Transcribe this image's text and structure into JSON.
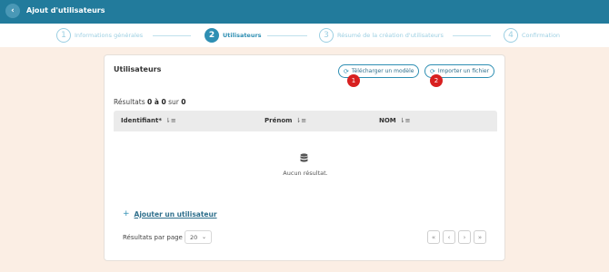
{
  "header": {
    "back_icon": "chevron-left-icon",
    "title": "Ajout d'utilisateurs"
  },
  "stepper": {
    "steps": [
      {
        "number": "1",
        "label": "Informations générales",
        "state": "done"
      },
      {
        "number": "2",
        "label": "Utilisateurs",
        "state": "active"
      },
      {
        "number": "3",
        "label": "Résumé de la création d'utilisateurs",
        "state": "pending"
      },
      {
        "number": "4",
        "label": "Confirmation",
        "state": "pending"
      }
    ]
  },
  "card": {
    "title": "Utilisateurs",
    "download_template_label": "Télécharger un modèle",
    "import_file_label": "Importer un fichier",
    "badges": [
      "1",
      "2"
    ],
    "results_prefix": "Résultats",
    "results_range": "0 à 0",
    "results_of": "sur",
    "results_total": "0"
  },
  "table": {
    "columns": [
      "Identifiant*",
      "Prénom",
      "NOM"
    ],
    "empty_message": "Aucun résultat."
  },
  "actions": {
    "add_user_label": "Ajouter un utilisateur"
  },
  "pagination": {
    "per_page_label": "Résultats par page",
    "per_page_value": "20",
    "buttons": [
      "«",
      "‹",
      "›",
      "»"
    ]
  },
  "colors": {
    "primary": "#227b9c",
    "accent": "#2f8fb3",
    "badge": "#d82020",
    "background": "#fbeee4"
  }
}
